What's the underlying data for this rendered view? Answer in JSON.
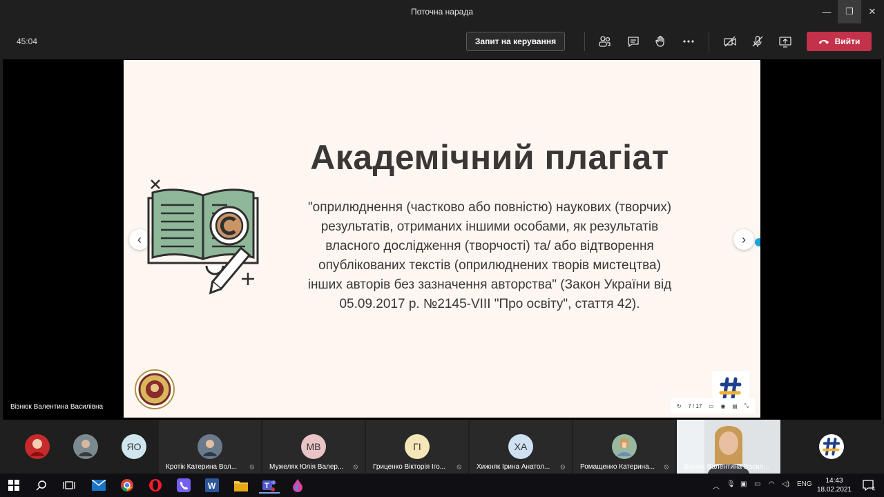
{
  "window": {
    "title": "Поточна нарада",
    "minimize": "—",
    "maximize": "❐",
    "close": "✕"
  },
  "toolbar": {
    "timer": "45:04",
    "request_control_label": "Запит на керування",
    "leave_label": "Вийти",
    "icons": [
      "participants-icon",
      "chat-icon",
      "raise-hand-icon",
      "more-icon",
      "camera-off-icon",
      "mic-off-icon",
      "share-icon"
    ],
    "leave_color": "#c4314b"
  },
  "slide": {
    "title": "Академічний плагіат",
    "body": "\"оприлюднення (частково або повністю) наукових (творчих) результатів, отриманих іншими особами, як результатів власного дослідження (творчості) та/ або відтворення опублікованих текстів (оприлюднених творів мистецтва) інших авторів без зазначення авторства\" (Закон України від 05.09.2017 р. №2145-VIII \"Про освіту\", стаття 42).",
    "page_indicator": "7 / 17",
    "prev": "‹",
    "next": "›",
    "background": "#fdf6f1",
    "book_color": "#8fb89a"
  },
  "presenter_name": "Візнюк Валентина Василівна",
  "participants": [
    {
      "type": "photo",
      "name": ""
    },
    {
      "type": "photo",
      "name": ""
    },
    {
      "type": "initials",
      "initials": "ЯО",
      "name": "",
      "color": "#cfe6ee"
    },
    {
      "type": "photo",
      "name": "Кротік Катерина Вол..."
    },
    {
      "type": "initials",
      "initials": "МВ",
      "name": "Мужеляк Юлія Валер...",
      "color": "#e9c3c6"
    },
    {
      "type": "initials",
      "initials": "ГІ",
      "name": "Гриценко Вікторія Іго...",
      "color": "#f5e6b8"
    },
    {
      "type": "initials",
      "initials": "ХА",
      "name": "Хижняк Ірина Анатол...",
      "color": "#cfe0f2"
    },
    {
      "type": "photo",
      "name": "Ромащенко Катерина..."
    },
    {
      "type": "video",
      "name": "Візнюк Валентина Васил..."
    },
    {
      "type": "logo",
      "name": ""
    }
  ],
  "taskbar": {
    "language": "ENG",
    "time": "14:43",
    "date": "18.02.2021",
    "notifications": "4"
  }
}
